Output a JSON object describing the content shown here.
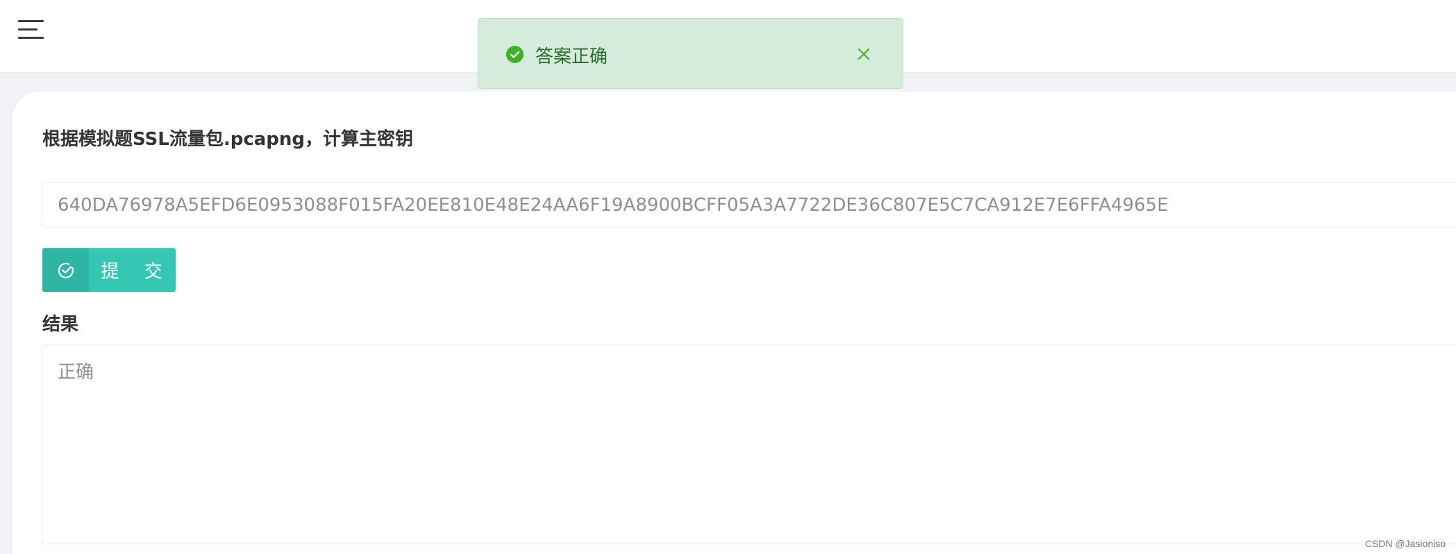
{
  "header": {
    "menu_icon": "hamburger-menu-icon"
  },
  "question": {
    "title": "根据模拟题SSL流量包.pcapng，计算主密钥",
    "answer_value": "640DA76978A5EFD6E0953088F015FA20EE810E48E24AA6F19A8900BCFF05A3A7722DE36C807E5C7CA912E7E6FFA4965E"
  },
  "submit": {
    "icon": "check-circle-icon",
    "label": "提 交",
    "color": "#36c6b4"
  },
  "result": {
    "label": "结果",
    "value": "正确"
  },
  "toast": {
    "icon": "success-check-icon",
    "message": "答案正确",
    "close_icon": "close-icon",
    "color": "#d5ecdc"
  },
  "watermark": "CSDN @Jasioniso"
}
